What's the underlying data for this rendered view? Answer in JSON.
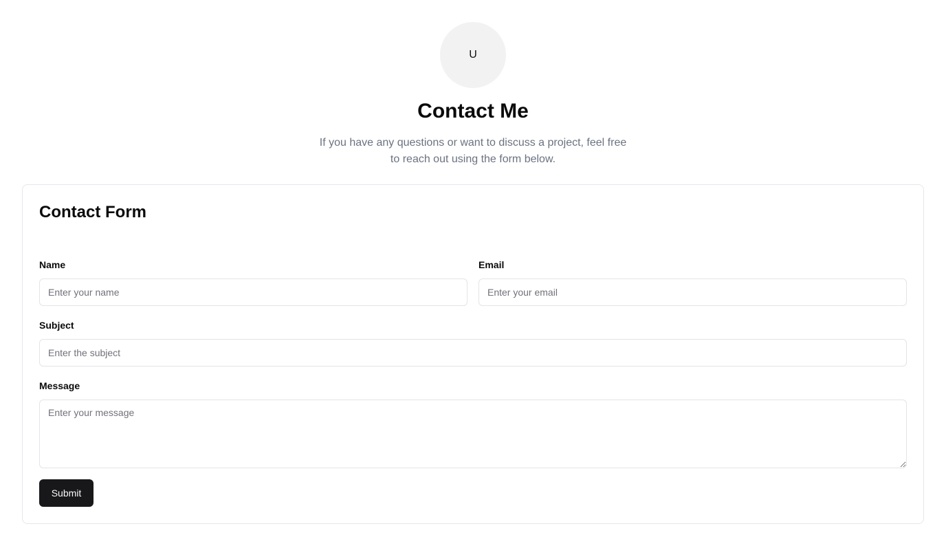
{
  "header": {
    "avatar_initial": "U",
    "title": "Contact Me",
    "intro": "If you have any questions or want to discuss a project, feel free to reach out using the form below."
  },
  "form": {
    "title": "Contact Form",
    "name": {
      "label": "Name",
      "placeholder": "Enter your name",
      "value": ""
    },
    "email": {
      "label": "Email",
      "placeholder": "Enter your email",
      "value": ""
    },
    "subject": {
      "label": "Subject",
      "placeholder": "Enter the subject",
      "value": ""
    },
    "message": {
      "label": "Message",
      "placeholder": "Enter your message",
      "value": ""
    },
    "submit_label": "Submit"
  },
  "colors": {
    "primary_button": "#18181b",
    "muted_text": "#6b7280",
    "border": "#e4e4e7",
    "avatar_bg": "#f2f2f2"
  }
}
